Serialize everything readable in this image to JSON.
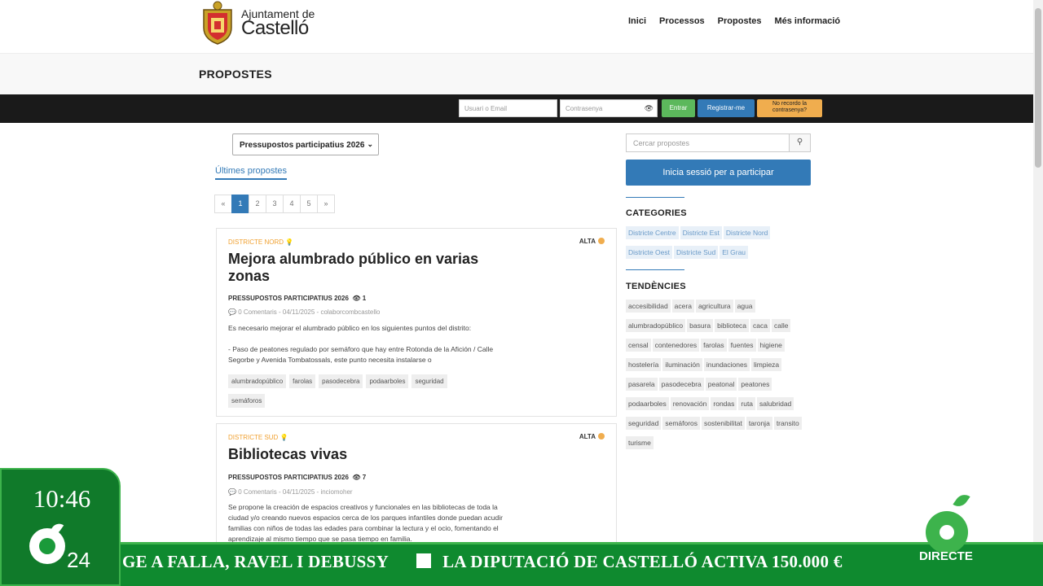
{
  "header": {
    "logo_small": "Ajuntament de",
    "logo_big": "Castelló",
    "nav": [
      "Inici",
      "Processos",
      "Propostes",
      "Més informació"
    ]
  },
  "page_title": "PROPOSTES",
  "login": {
    "user_placeholder": "Usuari o Email",
    "pass_placeholder": "Contrasenya",
    "enter": "Entrar",
    "register": "Registrar-me",
    "forgot": "No recordo la contrasenya?"
  },
  "filter": {
    "selected": "Pressupostos participatius 2026"
  },
  "tabs": {
    "latest": "Últimes propostes"
  },
  "pagination": [
    "«",
    "1",
    "2",
    "3",
    "4",
    "5",
    "»"
  ],
  "proposals": [
    {
      "district": "DISTRICTE NORD",
      "priority": "ALTA",
      "title": "Mejora alumbrado público en varias zonas",
      "program": "PRESSUPOSTOS PARTICIPATIUS 2026",
      "views": "1",
      "meta": "0 Comentaris - 04/11/2025 - colaborcombcastello",
      "desc1": "Es necesario mejorar el alumbrado público en los siguientes puntos del distrito:",
      "desc2": "- Paso de peatones regulado por semáforo que hay entre Rotonda de la Afición / Calle Segorbe y Avenida Tombatossals, este punto necesita instalarse o",
      "tags": [
        "alumbradopúblico",
        "farolas",
        "pasodecebra",
        "podaarboles",
        "seguridad",
        "semáforos"
      ]
    },
    {
      "district": "DISTRICTE SUD",
      "priority": "ALTA",
      "title": "Bibliotecas vivas",
      "program": "PRESSUPOSTOS PARTICIPATIUS 2026",
      "views": "7",
      "meta": "0 Comentaris - 04/11/2025 - inciomoher",
      "desc1": "Se propone la creación de espacios creativos y funcionales en las bibliotecas de toda la ciudad y/o creando nuevos espacios cerca de los parques infantiles donde puedan acudir familias con niños de todas las edades para combinar la lectura y el ocio, fomentando el aprendizaje al mismo tiempo que se pasa tiempo en familia."
    }
  ],
  "sidebar": {
    "search_placeholder": "Cercar propostes",
    "login_cta": "Inicia sessió per a participar",
    "categories_title": "CATEGORIES",
    "categories": [
      "Districte Centre",
      "Districte Est",
      "Districte Nord",
      "Districte Oest",
      "Districte Sud",
      "El Grau"
    ],
    "trends_title": "TENDÈNCIES",
    "trends": [
      "accesibilidad",
      "acera",
      "agricultura",
      "agua",
      "alumbradopúblico",
      "basura",
      "biblioteca",
      "caca",
      "calle",
      "censal",
      "contenedores",
      "farolas",
      "fuentes",
      "higiene",
      "hostelería",
      "iluminación",
      "inundaciones",
      "limpieza",
      "pasarela",
      "pasodecebra",
      "peatonal",
      "peatones",
      "podaarboles",
      "renovación",
      "rondas",
      "ruta",
      "salubridad",
      "seguridad",
      "semáforos",
      "sostenibilitat",
      "taronja",
      "transito",
      "turisme"
    ]
  },
  "tv": {
    "clock": "10:46",
    "channel": "24",
    "ticker1": "GE A FALLA, RAVEL I DEBUSSY",
    "ticker2": "LA DIPUTACIÓ DE CASTELLÓ ACTIVA 150.000 €",
    "live": "DIRECTE"
  }
}
